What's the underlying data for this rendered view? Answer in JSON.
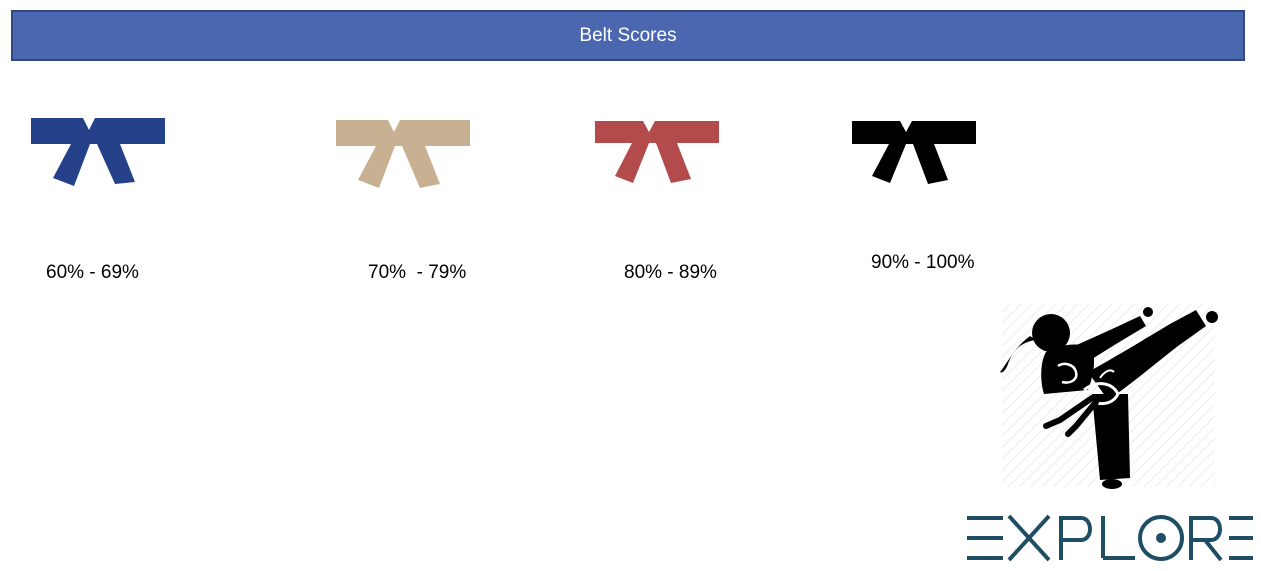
{
  "header": {
    "title": "Belt Scores",
    "background": "#4a67af",
    "border": "#2f4a80"
  },
  "belts": [
    {
      "name": "blue-belt",
      "color": "#25418a",
      "range": "60% - 69%"
    },
    {
      "name": "tan-belt",
      "color": "#c8b193",
      "range": "70%  - 79%"
    },
    {
      "name": "red-belt",
      "color": "#b34b4c",
      "range": "80% - 89%"
    },
    {
      "name": "black-belt",
      "color": "#000000",
      "range": "90% - 100%"
    }
  ],
  "illustration": {
    "icon": "karate-kick-icon"
  },
  "logo": {
    "text": "EXPLORE",
    "color": "#1f4e64"
  }
}
